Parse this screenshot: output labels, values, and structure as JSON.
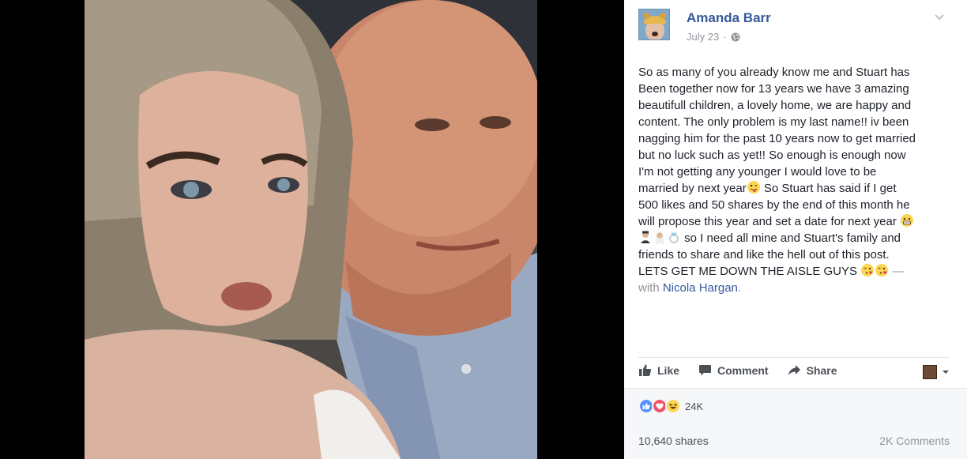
{
  "post": {
    "author": "Amanda Barr",
    "date": "July 23",
    "date_separator": "·",
    "privacy_icon": "globe-icon",
    "options_icon": "chevron-down-icon",
    "text_lines": [
      "So as many of you already know me and Stuart has",
      "Been together now for 13 years we have 3 amazing",
      "beautifull children, a lovely home, we are happy and",
      "content. The only problem is my last name!! iv been",
      "nagging him for the past 10 years now to get married",
      "but no luck such as yet!! So enough is enough now",
      "I'm not getting any younger I would love to be"
    ],
    "line8_before_emoji": "married by next year",
    "line8_after_emoji": " So Stuart has said if I get",
    "line9": "500 likes and 50 shares by the end of this month he",
    "line10_before_emoji": "will propose this year and set a date for next year ",
    "line11_after_emoji": " so I need all mine and Stuart's family and",
    "line12": "friends to share and like the hell out of this post.",
    "line13": "LETS GET ME DOWN THE AISLE GUYS ",
    "line13_after": " —",
    "with_label": "with ",
    "tagged": "Nicola Hargan",
    "tagged_after": "."
  },
  "actions": {
    "like": "Like",
    "comment": "Comment",
    "share": "Share"
  },
  "stats": {
    "reactions_count": "24K",
    "reaction_icons": [
      "like-reaction-icon",
      "love-reaction-icon",
      "haha-reaction-icon"
    ],
    "shares": "10,640 shares",
    "comments": "2K Comments"
  },
  "colors": {
    "link": "#365899",
    "meta": "#90949c",
    "like_blue": "#5890ff",
    "love_red": "#f25268",
    "haha_yellow": "#fcd553"
  }
}
